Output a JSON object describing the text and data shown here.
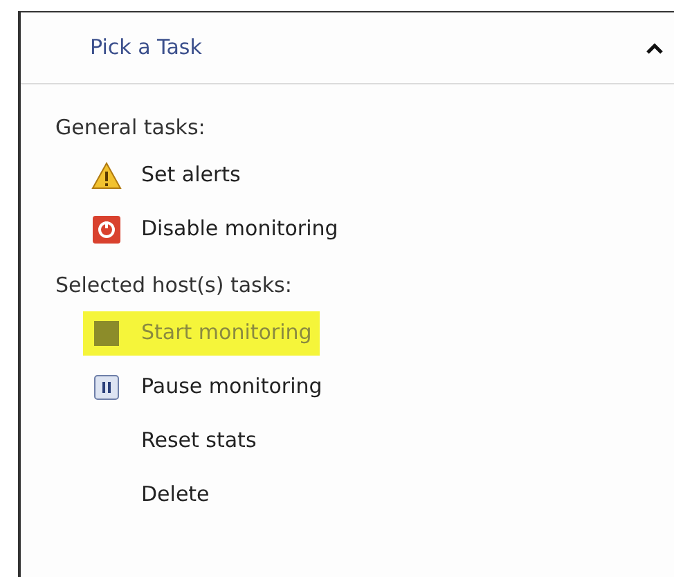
{
  "panel": {
    "title": "Pick a Task",
    "expanded": true,
    "groups": [
      {
        "heading": "General tasks:",
        "items": [
          {
            "label": "Set alerts",
            "kind": "warning",
            "highlighted": false,
            "disabled": false
          },
          {
            "label": "Disable monitoring",
            "kind": "stop",
            "highlighted": false,
            "disabled": false
          }
        ]
      },
      {
        "heading": "Selected host(s) tasks:",
        "items": [
          {
            "label": "Start monitoring",
            "kind": "start",
            "highlighted": true,
            "disabled": true
          },
          {
            "label": "Pause monitoring",
            "kind": "pause",
            "highlighted": false,
            "disabled": false
          },
          {
            "label": "Reset stats",
            "kind": "none",
            "highlighted": false,
            "disabled": false
          },
          {
            "label": "Delete",
            "kind": "none",
            "highlighted": false,
            "disabled": false
          }
        ]
      }
    ]
  }
}
